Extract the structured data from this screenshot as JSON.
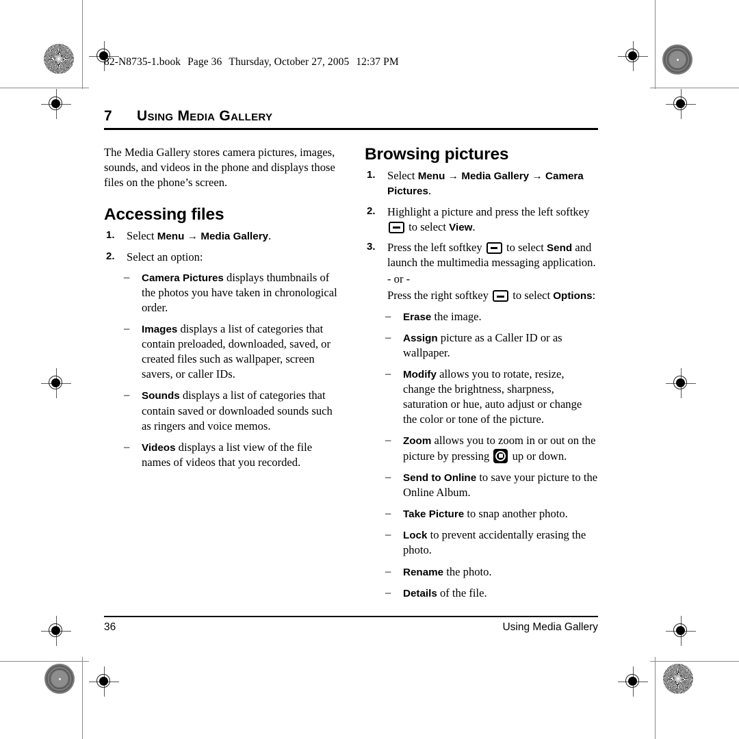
{
  "header": {
    "book_file": "82-N8735-1.book",
    "page_label": "Page 36",
    "date": "Thursday, October 27, 2005",
    "time": "12:37 PM"
  },
  "chapter": {
    "number": "7",
    "title": "Using Media Gallery"
  },
  "left_column": {
    "intro": "The Media Gallery stores camera pictures, images, sounds, and videos in the phone and displays those files on the phone’s screen.",
    "section_title": "Accessing files",
    "steps": [
      {
        "num": "1.",
        "pre": "Select ",
        "ui1": "Menu",
        "arrow": "→",
        "ui2": "Media Gallery",
        "post": "."
      },
      {
        "num": "2.",
        "text": "Select an option:"
      }
    ],
    "options": [
      {
        "dash": "–",
        "term": "Camera Pictures",
        "text": " displays thumbnails of the photos you have taken in chronological order."
      },
      {
        "dash": "–",
        "term": "Images",
        "text": " displays a list of categories that contain preloaded, downloaded, saved, or created files such as wallpaper, screen savers, or caller IDs."
      },
      {
        "dash": "–",
        "term": "Sounds",
        "text": " displays a list of categories that contain saved or downloaded sounds such as ringers and voice memos."
      },
      {
        "dash": "–",
        "term": "Videos",
        "text": " displays a list view of the file names of videos that you recorded."
      }
    ]
  },
  "right_column": {
    "section_title": "Browsing pictures",
    "step1": {
      "num": "1.",
      "pre": "Select ",
      "ui1": "Menu",
      "arrow1": "→",
      "ui2": "Media Gallery",
      "arrow2": "→",
      "ui3": "Camera Pictures",
      "post": "."
    },
    "step2": {
      "num": "2.",
      "pre": "Highlight a picture and press the left softkey ",
      "icon": "softkey-icon",
      "mid": " to select ",
      "ui": "View",
      "post": "."
    },
    "step3": {
      "num": "3.",
      "pre": "Press the left softkey ",
      "icon1": "softkey-icon",
      "mid1": " to select ",
      "ui1": "Send",
      "post1": " and launch the multimedia messaging application.",
      "or": "- or -",
      "pre2": "Press the right softkey ",
      "icon2": "softkey-icon",
      "mid2": " to select ",
      "ui2": "Options",
      "post2": ":"
    },
    "options": [
      {
        "dash": "–",
        "term": "Erase",
        "text": " the image."
      },
      {
        "dash": "–",
        "term": "Assign",
        "text": " picture as a Caller ID or as wallpaper."
      },
      {
        "dash": "–",
        "term": "Modify",
        "text": " allows you to rotate, resize, change the brightness, sharpness, saturation or hue, auto adjust or change the color or tone of the picture."
      },
      {
        "dash": "–",
        "term": "Zoom",
        "text_before": " allows you to zoom in or out on the picture by pressing ",
        "icon": "nav-key-icon",
        "text_after": " up or down."
      },
      {
        "dash": "–",
        "term": "Send to Online",
        "text": " to save your picture to the Online Album."
      },
      {
        "dash": "–",
        "term": "Take Picture",
        "text": " to snap another photo."
      },
      {
        "dash": "–",
        "term": "Lock",
        "text": " to prevent accidentally erasing the photo."
      },
      {
        "dash": "–",
        "term": "Rename",
        "text": " the photo."
      },
      {
        "dash": "–",
        "term": "Details",
        "text": " of the file."
      }
    ]
  },
  "footer": {
    "page_number": "36",
    "running_title": "Using Media Gallery"
  },
  "colors": {
    "text": "#000000",
    "rule": "#000000",
    "trim_line": "#8a8a8a"
  }
}
